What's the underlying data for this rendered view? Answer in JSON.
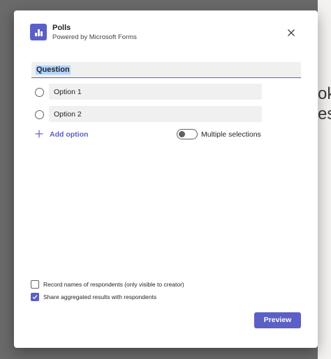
{
  "backdrop": {
    "fragment_1": "ok",
    "fragment_2": "es"
  },
  "header": {
    "app_icon": "poll-chart-icon",
    "title": "Polls",
    "subtitle": "Powered by Microsoft Forms",
    "close_icon": "close-icon"
  },
  "question": {
    "value": "Question"
  },
  "options": [
    {
      "label": "Option 1"
    },
    {
      "label": "Option 2"
    }
  ],
  "add_option": {
    "label": "Add option",
    "icon": "plus-icon"
  },
  "multiple_selections": {
    "label": "Multiple selections",
    "enabled": false
  },
  "settings": [
    {
      "label": "Record names of respondents (only visible to creator)",
      "checked": false
    },
    {
      "label": "Share aggregated results with respondents",
      "checked": true
    }
  ],
  "footer": {
    "preview_label": "Preview"
  },
  "colors": {
    "accent": "#5b5fc7",
    "overlay": "#6a6a6a",
    "field_background": "#f0f0f0"
  }
}
